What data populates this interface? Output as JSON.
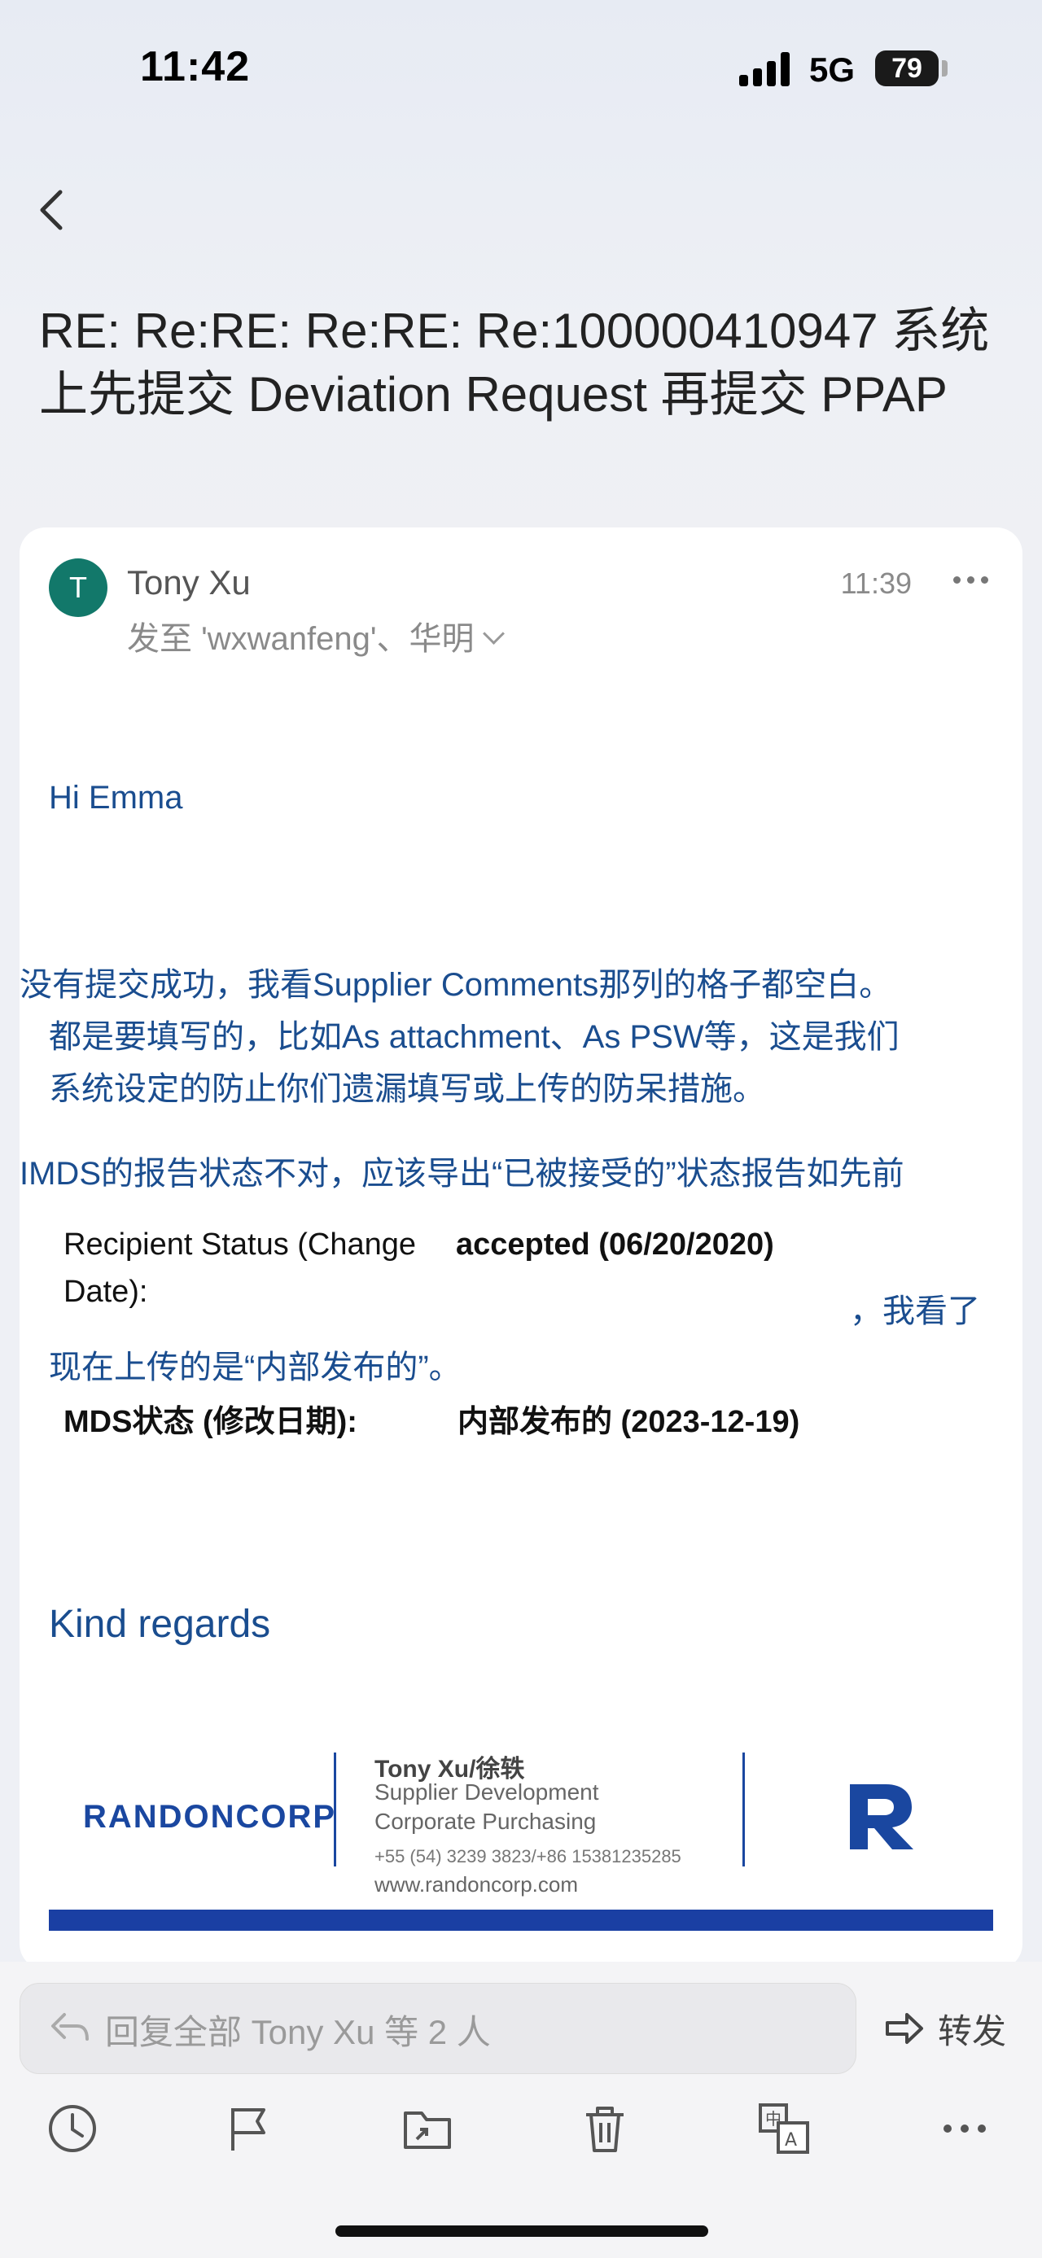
{
  "status_bar": {
    "time": "11:42",
    "network": "5G",
    "battery": "79"
  },
  "email": {
    "subject": "RE: Re:RE: Re:RE: Re:100000410947 系统上先提交 Deviation Request 再提交 PPAP",
    "avatar_initial": "T",
    "sender": "Tony Xu",
    "recipients": "发至 'wxwanfeng'、华明",
    "time": "11:39",
    "greeting": "Hi Emma",
    "para1_line1": "没有提交成功，我看Supplier Comments那列的格子都空白。",
    "para1_line2": "都是要填写的，比如As attachment、As PSW等，这是我们",
    "para1_line3": "系统设定的防止你们遗漏填写或上传的防呆措施。",
    "para2_line1": "IMDS的报告状态不对，应该导出“已被接受的”状态报告如先前",
    "pasted1_label": "Recipient Status (Change Date):",
    "pasted1_value": "accepted (06/20/2020)",
    "para2_tail": "，我看了",
    "para2_line2": "现在上传的是“内部发布的”。",
    "pasted2_label": "MDS状态 (修改日期):",
    "pasted2_value": "内部发布的 (2023-12-19)",
    "closing": "Kind regards"
  },
  "signature": {
    "company": "RANDONCORP",
    "name": "Tony Xu/徐轶",
    "role1": "Supplier Development",
    "role2": "Corporate Purchasing",
    "phone": "+55 (54) 3239 3823/+86 15381235285",
    "website": "www.randoncorp.com",
    "brand_color": "#1a3fa3"
  },
  "reply_bar": {
    "reply_placeholder": "回复全部  Tony Xu 等 2 人",
    "forward_label": "转发"
  },
  "toolbar": {
    "icons": [
      "clock-icon",
      "flag-icon",
      "move-folder-icon",
      "trash-icon",
      "translate-icon",
      "more-icon"
    ]
  }
}
